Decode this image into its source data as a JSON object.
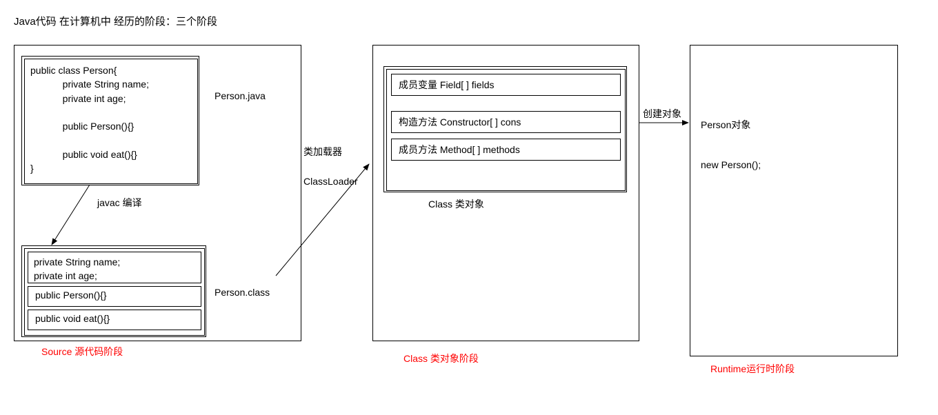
{
  "title": "Java代码 在计算机中 经历的阶段：三个阶段",
  "source": {
    "java_filename": "Person.java",
    "class_filename": "Person.class",
    "compile_label": "javac 编译",
    "java_code": "public class Person{\n            private String name;\n            private int age;\n\n            public Person(){}\n\n            public void eat(){}\n}",
    "class_parts": {
      "fields": "private String name;\nprivate int age;",
      "constructor": "public Person(){}",
      "method": "public void eat(){}"
    },
    "stage_label": "Source 源代码阶段"
  },
  "loader": {
    "name1": "类加载器",
    "name2": "ClassLoader"
  },
  "class_stage": {
    "fields_label": "成员变量  Field[ ] fields",
    "cons_label": "构造方法  Constructor[ ] cons",
    "methods_label": "成员方法 Method[ ] methods",
    "object_label": "Class 类对象",
    "stage_label": "Class 类对象阶段"
  },
  "create": {
    "label": "创建对象"
  },
  "runtime": {
    "obj_label": "Person对象",
    "new_expr": "new Person();",
    "stage_label": "Runtime运行时阶段"
  }
}
